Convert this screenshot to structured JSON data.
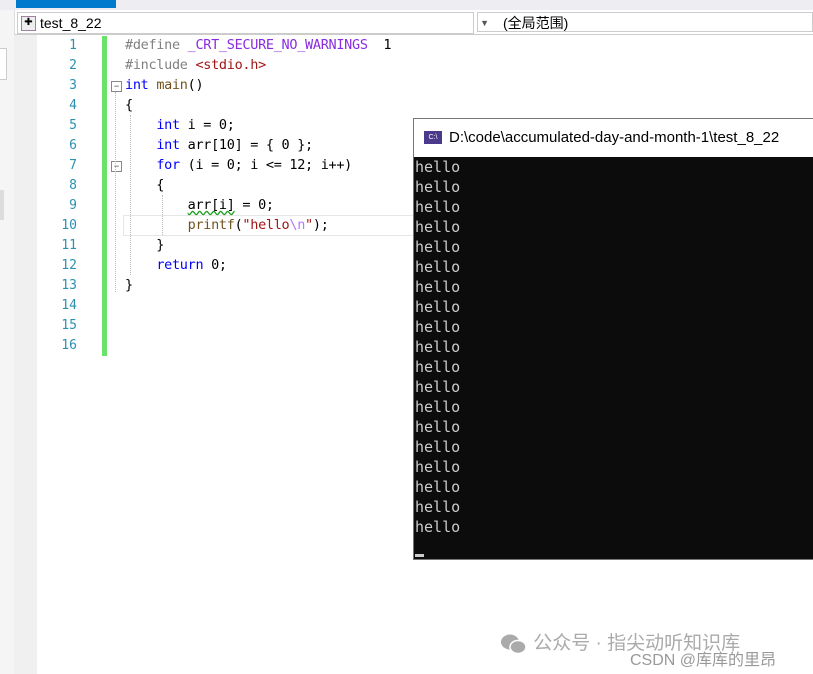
{
  "navbar": {
    "project": "test_8_22",
    "scope": "(全局范围)"
  },
  "editor": {
    "line_numbers": [
      "1",
      "2",
      "3",
      "4",
      "5",
      "6",
      "7",
      "8",
      "9",
      "10",
      "11",
      "12",
      "13",
      "14",
      "15",
      "16"
    ],
    "lines": [
      [
        [
          "pp",
          "#define "
        ],
        [
          "mac",
          "_CRT_SECURE_NO_WARNINGS"
        ],
        [
          "",
          "  1"
        ]
      ],
      [
        [
          "pp",
          "#include "
        ],
        [
          "str",
          "<stdio.h>"
        ]
      ],
      [
        [
          "kw",
          "int"
        ],
        [
          "",
          " "
        ],
        [
          "fn",
          "main"
        ],
        [
          "",
          "()"
        ]
      ],
      [
        [
          "",
          "{"
        ]
      ],
      [
        [
          "",
          "    "
        ],
        [
          "kw",
          "int"
        ],
        [
          "",
          " i = 0;"
        ]
      ],
      [
        [
          "",
          "    "
        ],
        [
          "kw",
          "int"
        ],
        [
          "",
          " arr[10] = { 0 };"
        ]
      ],
      [
        [
          "",
          "    "
        ],
        [
          "kw",
          "for"
        ],
        [
          "",
          " (i = 0; i <= 12; i++)"
        ]
      ],
      [
        [
          "",
          "    {"
        ]
      ],
      [
        [
          "",
          "        "
        ],
        [
          "sq",
          "arr[i]"
        ],
        [
          "",
          " = 0;"
        ]
      ],
      [
        [
          "",
          "        "
        ],
        [
          "fn",
          "printf"
        ],
        [
          "",
          "("
        ],
        [
          "str",
          "\"hello"
        ],
        [
          "esc",
          "\\n"
        ],
        [
          "str",
          "\""
        ],
        [
          "",
          ");"
        ]
      ],
      [
        [
          "",
          "    }"
        ]
      ],
      [
        [
          "",
          "    "
        ],
        [
          "kw",
          "return"
        ],
        [
          "",
          " 0;"
        ]
      ],
      [
        [
          "",
          "}"
        ]
      ],
      [],
      [],
      []
    ]
  },
  "console": {
    "title": "D:\\code\\accumulated-day-and-month-1\\test_8_22",
    "icon_label": "C:\\",
    "output": [
      "hello",
      "hello",
      "hello",
      "hello",
      "hello",
      "hello",
      "hello",
      "hello",
      "hello",
      "hello",
      "hello",
      "hello",
      "hello",
      "hello",
      "hello",
      "hello",
      "hello",
      "hello",
      "hello"
    ]
  },
  "watermark": {
    "wechat": "公众号 · 指尖动听知识库",
    "csdn": "CSDN @库库的里昂"
  }
}
